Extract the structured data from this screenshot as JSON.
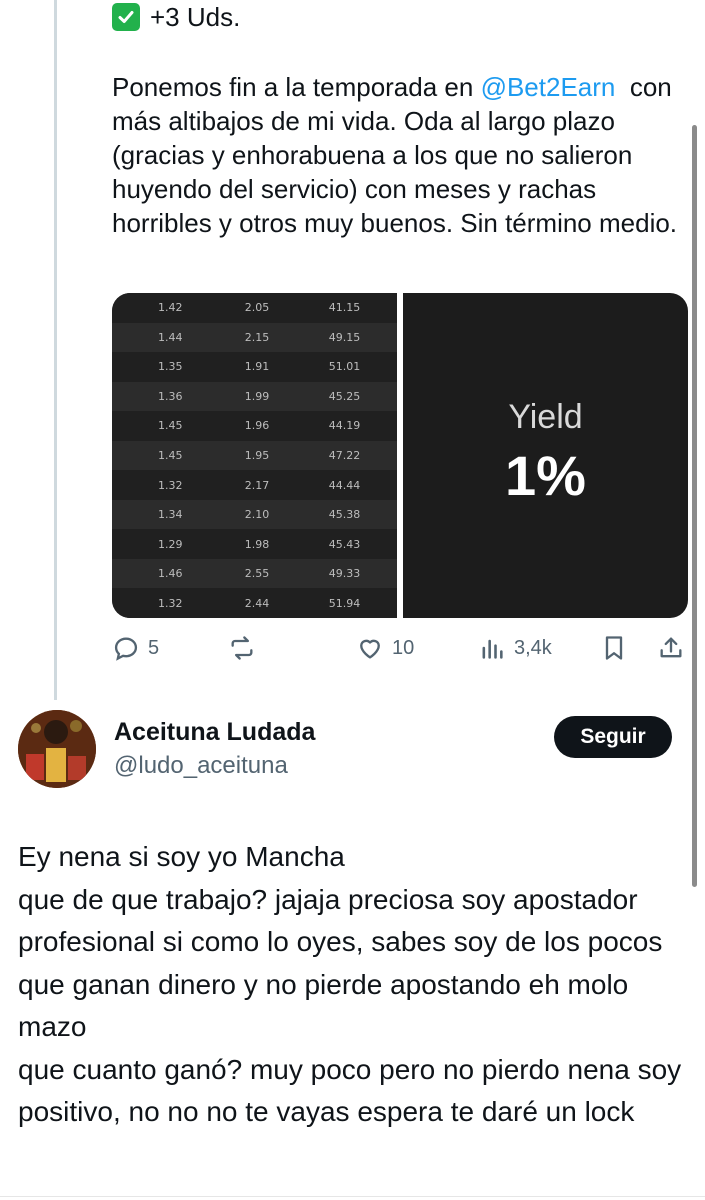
{
  "tweet1": {
    "top_line": "+3 Uds.",
    "body_prefix": "Ponemos fin a la temporada en ",
    "mention": "@Bet2Earn",
    "body_suffix": "  con más altibajos de mi vida. Oda al largo plazo (gracias y enhorabuena a los que no salieron huyendo del servicio) con meses y rachas horribles y otros muy buenos. Sin término medio.",
    "media": {
      "table_rows": [
        [
          "1.42",
          "2.05",
          "41.15"
        ],
        [
          "1.44",
          "2.15",
          "49.15"
        ],
        [
          "1.35",
          "1.91",
          "51.01"
        ],
        [
          "1.36",
          "1.99",
          "45.25"
        ],
        [
          "1.45",
          "1.96",
          "44.19"
        ],
        [
          "1.45",
          "1.95",
          "47.22"
        ],
        [
          "1.32",
          "2.17",
          "44.44"
        ],
        [
          "1.34",
          "2.10",
          "45.38"
        ],
        [
          "1.29",
          "1.98",
          "45.43"
        ],
        [
          "1.46",
          "2.55",
          "49.33"
        ],
        [
          "1.32",
          "2.44",
          "51.94"
        ]
      ],
      "yield_label": "Yield",
      "yield_value": "1%"
    },
    "actions": {
      "replies": "5",
      "reposts": "",
      "likes": "10",
      "views": "3,4k"
    }
  },
  "tweet2": {
    "user_name": "Aceituna Ludada",
    "user_handle": "@ludo_aceituna",
    "follow_label": "Seguir",
    "text": "Ey nena si soy yo Mancha\nque de que trabajo? jajaja preciosa soy apostador profesional si como lo oyes, sabes soy de los pocos que ganan dinero y no pierde apostando eh molo mazo\nque cuanto ganó? muy poco pero no pierdo nena soy positivo, no no no te vayas espera te daré un lock"
  },
  "colors": {
    "text": "#0f1419",
    "secondary": "#536471",
    "mention": "#1d9bf0",
    "check": "#22b14c",
    "media_bg": "#1c1c1c"
  }
}
